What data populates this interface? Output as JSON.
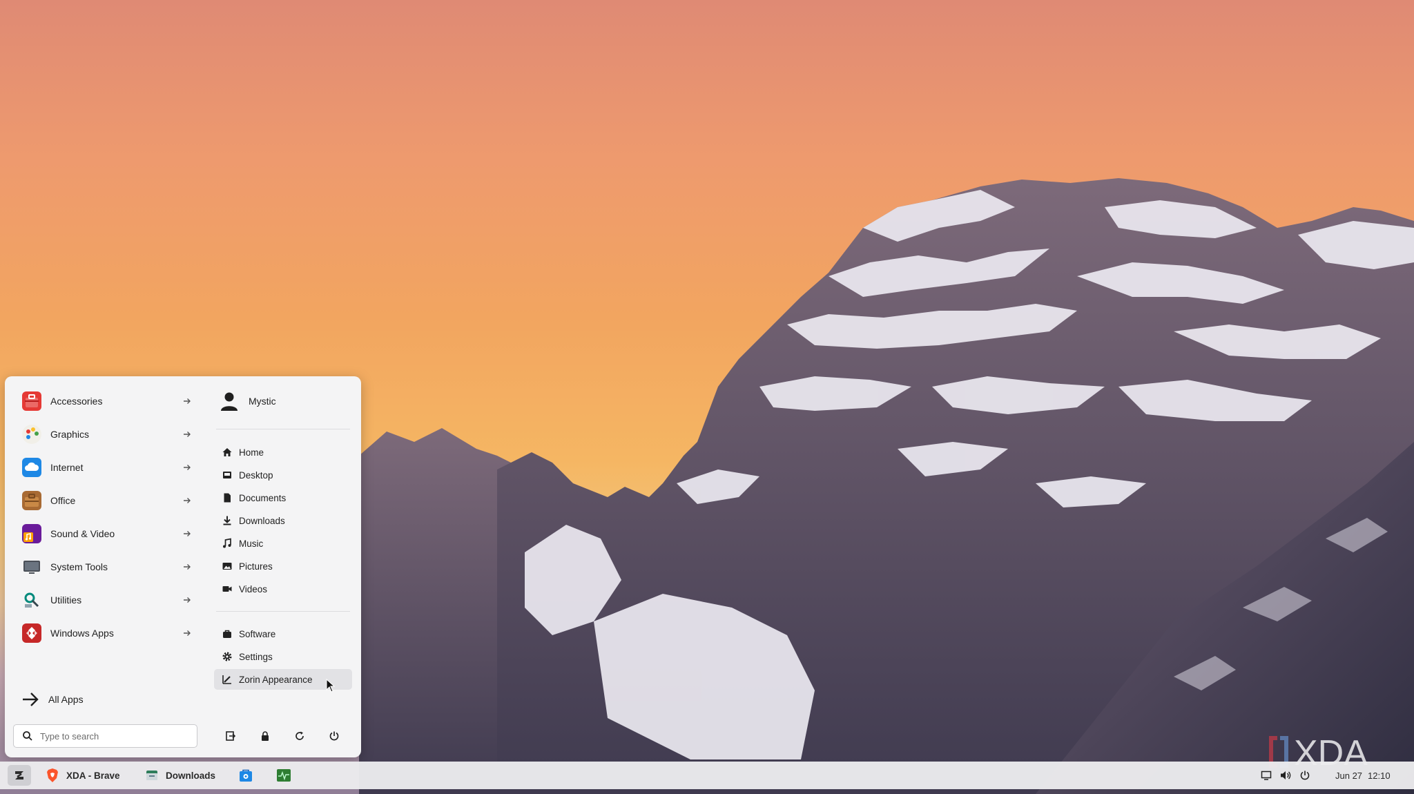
{
  "start_menu": {
    "categories": [
      {
        "label": "Accessories",
        "icon": "toolbox-icon"
      },
      {
        "label": "Graphics",
        "icon": "palette-icon"
      },
      {
        "label": "Internet",
        "icon": "cloud-icon"
      },
      {
        "label": "Office",
        "icon": "briefcase-icon"
      },
      {
        "label": "Sound & Video",
        "icon": "music-note-icon"
      },
      {
        "label": "System Tools",
        "icon": "monitor-icon"
      },
      {
        "label": "Utilities",
        "icon": "utilities-icon"
      },
      {
        "label": "Windows Apps",
        "icon": "wine-icon"
      }
    ],
    "all_apps": "All Apps",
    "search_placeholder": "Type to search",
    "user_name": "Mystic",
    "places": [
      {
        "label": "Home",
        "icon": "home-icon"
      },
      {
        "label": "Desktop",
        "icon": "desktop-folder-icon"
      },
      {
        "label": "Documents",
        "icon": "document-icon"
      },
      {
        "label": "Downloads",
        "icon": "download-icon"
      },
      {
        "label": "Music",
        "icon": "music-icon"
      },
      {
        "label": "Pictures",
        "icon": "picture-icon"
      },
      {
        "label": "Videos",
        "icon": "video-camera-icon"
      }
    ],
    "system": [
      {
        "label": "Software",
        "icon": "software-bag-icon"
      },
      {
        "label": "Settings",
        "icon": "gear-icon"
      },
      {
        "label": "Zorin Appearance",
        "icon": "appearance-brush-icon"
      }
    ],
    "session_buttons": [
      "log-out-icon",
      "lock-icon",
      "restart-icon",
      "power-icon"
    ]
  },
  "taskbar": {
    "tasks": [
      {
        "label": "XDA - Brave",
        "icon": "brave-icon"
      },
      {
        "label": "Downloads",
        "icon": "file-manager-icon"
      },
      {
        "label": "",
        "icon": "software-store-icon"
      },
      {
        "label": "",
        "icon": "system-monitor-icon"
      }
    ],
    "date": "Jun 27",
    "time": "12:10"
  },
  "watermark": "XDA",
  "colors": {
    "menu_bg": "#f4f4f5",
    "taskbar_bg": "#ececee",
    "hover_bg": "#e2e2e5"
  }
}
